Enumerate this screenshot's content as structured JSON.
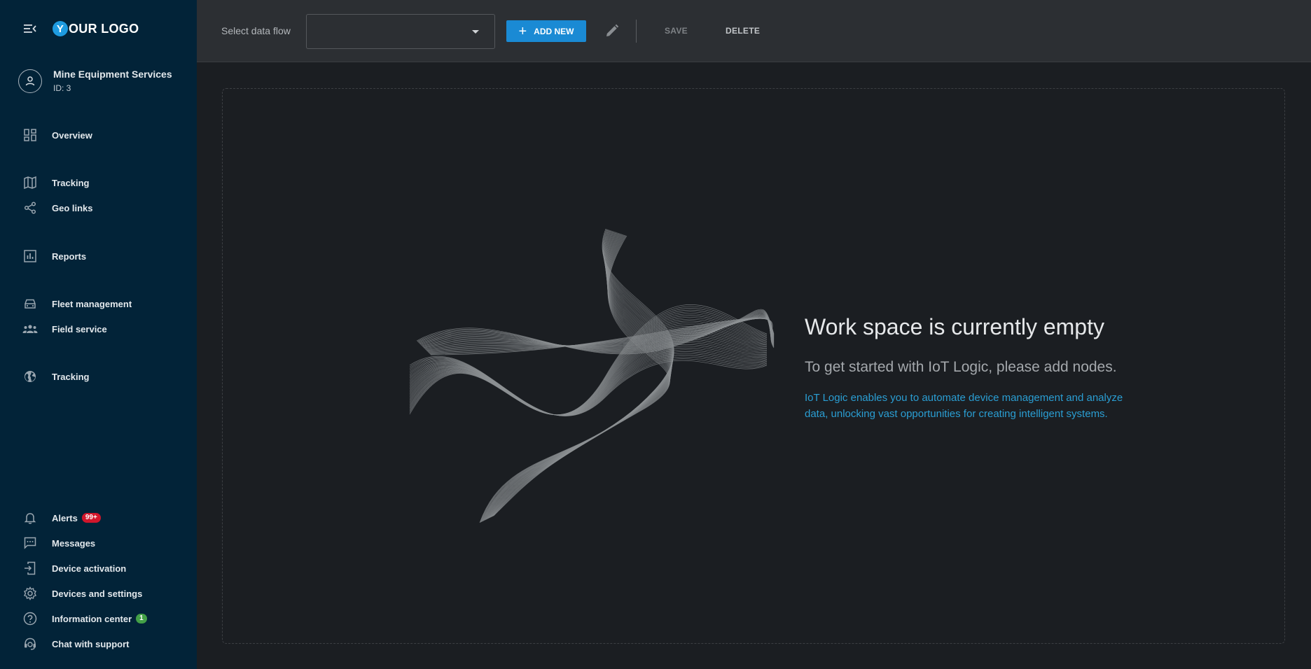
{
  "sidebar": {
    "logo_letter": "Y",
    "logo_text": "OUR LOGO",
    "account": {
      "name": "Mine Equipment Services",
      "id": "ID: 3"
    },
    "items": [
      {
        "label": "Overview",
        "icon": "dashboard-icon"
      },
      {
        "label": "Tracking",
        "icon": "map-icon"
      },
      {
        "label": "Geo links",
        "icon": "share-icon"
      },
      {
        "label": "Reports",
        "icon": "bar-chart-icon"
      },
      {
        "label": "Fleet management",
        "icon": "car-icon"
      },
      {
        "label": "Field service",
        "icon": "people-icon"
      },
      {
        "label": "Tracking",
        "icon": "globe-icon"
      }
    ],
    "bottom_items": [
      {
        "label": "Alerts",
        "icon": "bell-icon",
        "badge": "99+"
      },
      {
        "label": "Messages",
        "icon": "message-icon"
      },
      {
        "label": "Device activation",
        "icon": "device-activation-icon"
      },
      {
        "label": "Devices and settings",
        "icon": "gear-icon"
      },
      {
        "label": "Information center",
        "icon": "help-icon",
        "badge": "1"
      },
      {
        "label": "Chat with support",
        "icon": "headset-icon"
      }
    ]
  },
  "toolbar": {
    "select_label": "Select data flow",
    "select_value": "",
    "add_label": "ADD NEW",
    "save_label": "SAVE",
    "delete_label": "DELETE"
  },
  "workspace": {
    "title": "Work space is currently empty",
    "subtitle": "To get started with IoT Logic, please add nodes.",
    "description": "IoT Logic enables you to automate device management and analyze data, unlocking vast opportunities for creating intelligent systems."
  },
  "colors": {
    "sidebar_bg": "#022338",
    "accent": "#1a8ad4",
    "link": "#2a9ed3",
    "badge_red": "#d1162b",
    "badge_green": "#43a047"
  }
}
